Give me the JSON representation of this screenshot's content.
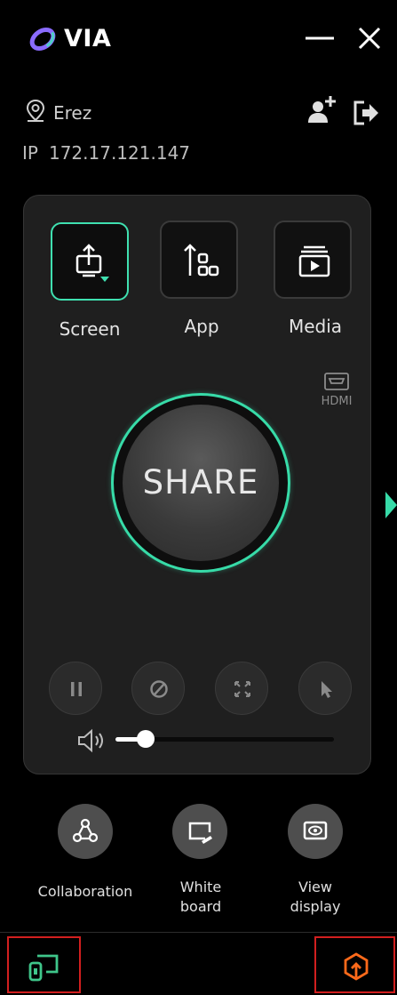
{
  "header": {
    "title": "VIA",
    "logo_icon": "via-logo-icon",
    "minimize_icon": "minimize-icon",
    "close_icon": "close-icon"
  },
  "user": {
    "name": "Erez",
    "ip_prefix": "IP",
    "ip": "172.17.121.147"
  },
  "sources": [
    {
      "label": "Screen",
      "icon": "screen-share-icon",
      "active": true
    },
    {
      "label": "App",
      "icon": "app-share-icon",
      "active": false
    },
    {
      "label": "Media",
      "icon": "media-share-icon",
      "active": false
    }
  ],
  "hdmi": {
    "label": "HDMI"
  },
  "share": {
    "label": "SHARE"
  },
  "controls": [
    "pause-icon",
    "stop-icon",
    "fullscreen-icon",
    "pointer-icon"
  ],
  "volume": {
    "level": 0.14
  },
  "actions": [
    {
      "label": "Collaboration",
      "icon": "collaboration-icon"
    },
    {
      "label_line1": "White",
      "label_line2": "board",
      "icon": "whiteboard-icon"
    },
    {
      "label_line1": "View",
      "label_line2": "display",
      "icon": "view-display-icon"
    }
  ],
  "colors": {
    "accent": "#37dba8",
    "highlight": "#d21f1f",
    "upload": "#ff6a1a",
    "devices": "#3fc68a"
  }
}
